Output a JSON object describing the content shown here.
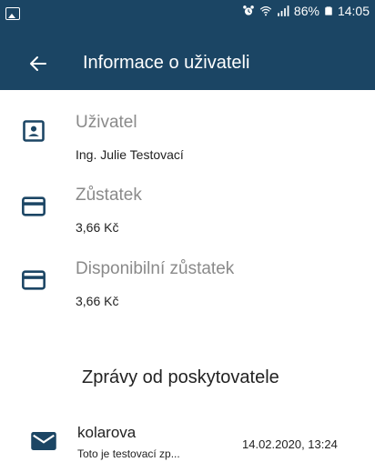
{
  "status_bar": {
    "battery": "86%",
    "time": "14:05",
    "icons": [
      "image-notification-icon",
      "alarm-icon",
      "wifi-icon",
      "signal-icon",
      "battery-icon"
    ]
  },
  "app_bar": {
    "title": "Informace o uživateli",
    "back_icon": "arrow-back-icon"
  },
  "user_info": [
    {
      "label": "Uživatel",
      "value": "Ing. Julie Testovací",
      "icon": "account-box-icon"
    },
    {
      "label": "Zůstatek",
      "value": "3,66 Kč",
      "icon": "credit-card-icon"
    },
    {
      "label": "Disponibilní zůstatek",
      "value": "3,66 Kč",
      "icon": "credit-card-icon"
    }
  ],
  "messages_section": {
    "title": "Zprávy od poskytovatele",
    "items": [
      {
        "sender": "kolarova",
        "preview": "Toto je testovací zp...",
        "date": "14.02.2020, 13:24",
        "icon": "mail-icon"
      }
    ]
  },
  "colors": {
    "primary": "#1b4564",
    "icon": "#1b4564",
    "label_gray": "#8a8a8a"
  }
}
